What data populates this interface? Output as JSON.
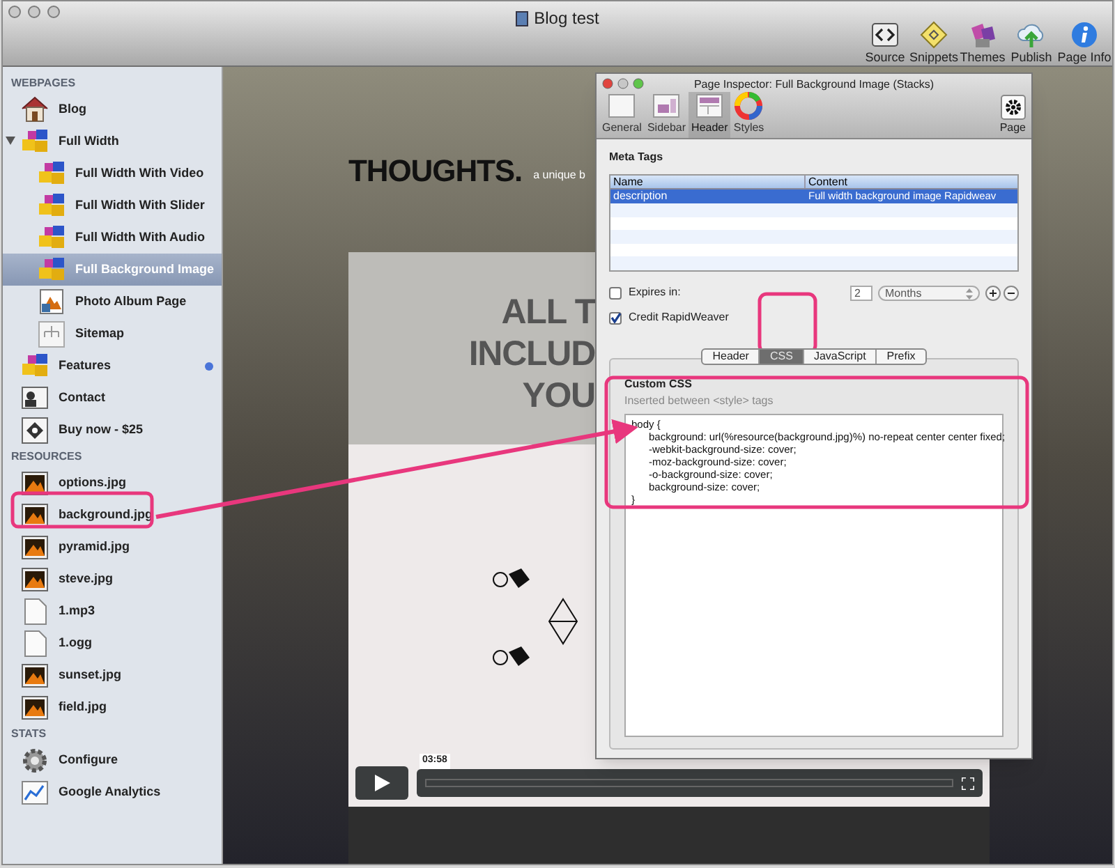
{
  "window": {
    "title": "Blog test"
  },
  "toolbar": [
    {
      "label": "Source",
      "kind": "source"
    },
    {
      "label": "Snippets",
      "kind": "snippets"
    },
    {
      "label": "Themes",
      "kind": "themes"
    },
    {
      "label": "Publish",
      "kind": "publish"
    },
    {
      "label": "Page Info",
      "kind": "info"
    }
  ],
  "sidebar": {
    "sections": [
      {
        "title": "WEBPAGES",
        "items": [
          {
            "label": "Blog",
            "kind": "home",
            "selected": false,
            "dot": false
          },
          {
            "label": "Full Width",
            "kind": "stack",
            "selected": false,
            "dot": false,
            "expanded": true,
            "children": [
              {
                "label": "Full Width With Video",
                "kind": "stack",
                "selected": false,
                "dot": false
              },
              {
                "label": "Full Width With Slider",
                "kind": "stack",
                "selected": false,
                "dot": false
              },
              {
                "label": "Full Width With Audio",
                "kind": "stack",
                "selected": false,
                "dot": false
              },
              {
                "label": "Full Background Image",
                "kind": "stack",
                "selected": true,
                "dot": false
              },
              {
                "label": "Photo Album Page",
                "kind": "album",
                "selected": false,
                "dot": false
              },
              {
                "label": "Sitemap",
                "kind": "sitemap",
                "selected": false,
                "dot": false
              }
            ]
          },
          {
            "label": "Features",
            "kind": "stack",
            "selected": false,
            "dot": true
          },
          {
            "label": "Contact",
            "kind": "contact",
            "selected": false,
            "dot": false
          },
          {
            "label": "Buy now - $25",
            "kind": "buy",
            "selected": false,
            "dot": false
          }
        ]
      },
      {
        "title": "RESOURCES",
        "items": [
          {
            "label": "options.jpg",
            "kind": "image",
            "selected": false,
            "dot": false
          },
          {
            "label": "background.jpg",
            "kind": "image",
            "selected": false,
            "dot": false
          },
          {
            "label": "pyramid.jpg",
            "kind": "image",
            "selected": false,
            "dot": false
          },
          {
            "label": "steve.jpg",
            "kind": "image",
            "selected": false,
            "dot": false
          },
          {
            "label": "1.mp3",
            "kind": "file",
            "selected": false,
            "dot": false
          },
          {
            "label": "1.ogg",
            "kind": "file",
            "selected": false,
            "dot": false
          },
          {
            "label": "sunset.jpg",
            "kind": "image",
            "selected": false,
            "dot": false
          },
          {
            "label": "field.jpg",
            "kind": "image",
            "selected": false,
            "dot": false
          }
        ]
      },
      {
        "title": "STATS",
        "items": [
          {
            "label": "Configure",
            "kind": "gear",
            "selected": false,
            "dot": false
          },
          {
            "label": "Google Analytics",
            "kind": "chart",
            "selected": false,
            "dot": false
          }
        ]
      }
    ]
  },
  "preview": {
    "site_title": "THOUGHTS.",
    "tagline": "a unique b",
    "headline": [
      "ALL T",
      "INCLUD",
      "YOU"
    ],
    "video": {
      "time": "03:58"
    }
  },
  "inspector": {
    "title": "Page Inspector: Full Background Image (Stacks)",
    "tabs": [
      {
        "label": "General",
        "kind": "general",
        "selected": false
      },
      {
        "label": "Sidebar",
        "kind": "sidebar",
        "selected": false
      },
      {
        "label": "Header",
        "kind": "header",
        "selected": true
      },
      {
        "label": "Styles",
        "kind": "styles",
        "selected": false
      }
    ],
    "page_button": "Page",
    "meta_tags": {
      "heading": "Meta Tags",
      "columns": [
        "Name",
        "Content"
      ],
      "rows": [
        {
          "name": "description",
          "content": "Full width background image Rapidweav",
          "selected": true
        }
      ]
    },
    "expires": {
      "label": "Expires in:",
      "checked": false,
      "value": "2",
      "unit": "Months"
    },
    "credit": {
      "label": "Credit RapidWeaver",
      "checked": true
    },
    "code_tabs": [
      {
        "label": "Header",
        "selected": false
      },
      {
        "label": "CSS",
        "selected": true
      },
      {
        "label": "JavaScript",
        "selected": false
      },
      {
        "label": "Prefix",
        "selected": false
      }
    ],
    "custom_css": {
      "heading": "Custom CSS",
      "hint": "Inserted between <style> tags",
      "lines": [
        "body {",
        "\tbackground: url(%resource(background.jpg)%) no-repeat center center fixed;",
        "\t-webkit-background-size: cover;",
        "\t-moz-background-size: cover;",
        "\t-o-background-size: cover;",
        "\tbackground-size: cover;",
        "}"
      ]
    }
  }
}
